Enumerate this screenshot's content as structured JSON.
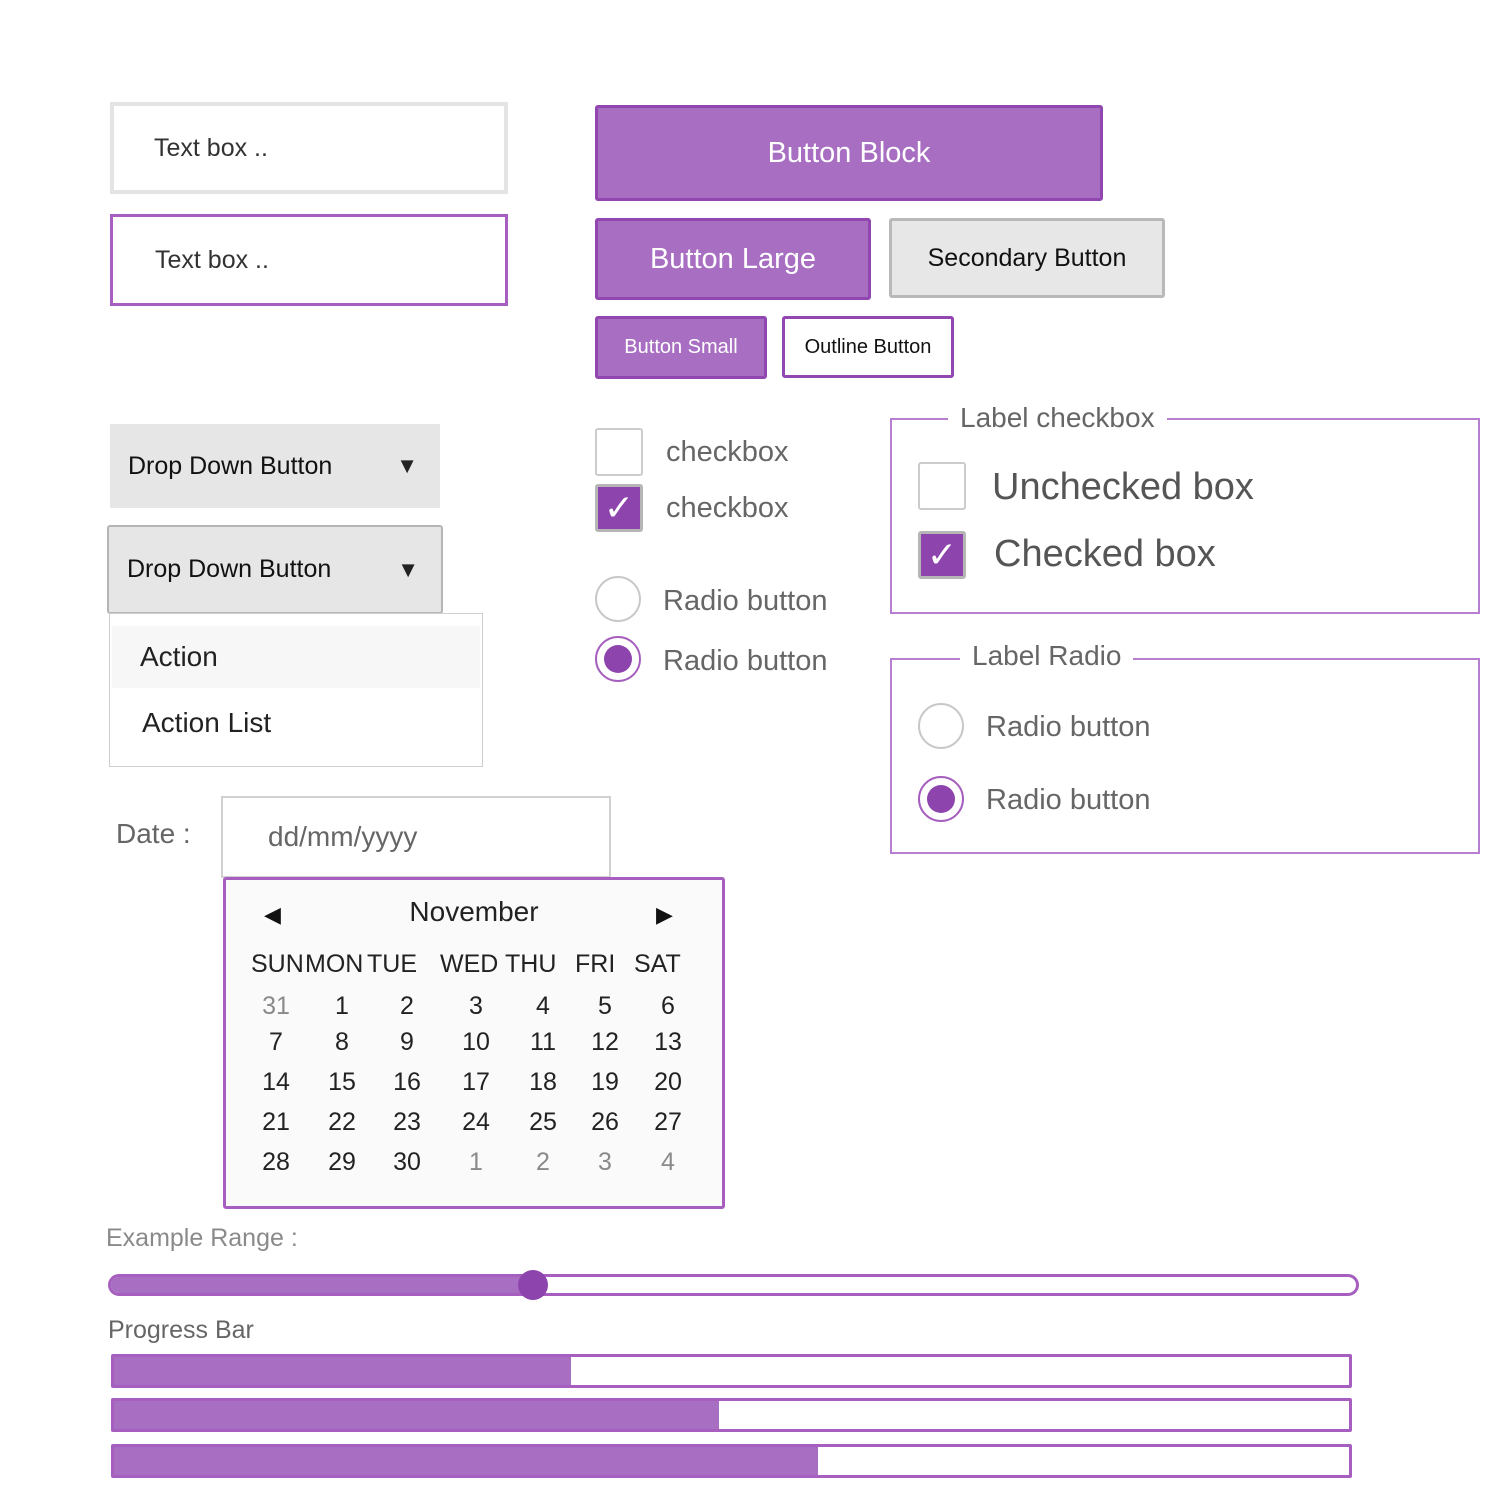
{
  "textboxes": [
    {
      "placeholder": "Text box .."
    },
    {
      "placeholder": "Text box .."
    }
  ],
  "buttons": {
    "block": "Button Block",
    "large": "Button Large",
    "secondary": "Secondary Button",
    "small": "Button Small",
    "outline": "Outline Button"
  },
  "dropdowns": [
    {
      "label": "Drop Down Button",
      "icon": "caret-down-icon"
    },
    {
      "label": "Drop Down Button",
      "icon": "caret-down-icon",
      "open": true
    }
  ],
  "dropdown_menu": [
    "Action",
    "Action List"
  ],
  "checkboxes": [
    {
      "label": "checkbox",
      "checked": false
    },
    {
      "label": "checkbox",
      "checked": true
    }
  ],
  "radios": [
    {
      "label": "Radio button",
      "selected": false
    },
    {
      "label": "Radio button",
      "selected": true
    }
  ],
  "checkbox_group": {
    "legend": "Label checkbox",
    "items": [
      {
        "label": "Unchecked box",
        "checked": false
      },
      {
        "label": "Checked box",
        "checked": true
      }
    ]
  },
  "radio_group": {
    "legend": "Label Radio",
    "items": [
      {
        "label": "Radio button",
        "selected": false
      },
      {
        "label": "Radio button",
        "selected": true
      }
    ]
  },
  "check_mark": "✓",
  "date": {
    "label": "Date :",
    "placeholder": "dd/mm/yyyy"
  },
  "calendar": {
    "month": "November",
    "prev_icon": "◀",
    "next_icon": "▶",
    "weekdays": [
      "SUN",
      "MON",
      "TUE",
      "WED",
      "THU",
      "FRI",
      "SAT"
    ],
    "weeks": [
      [
        "31",
        "1",
        "2",
        "3",
        "4",
        "5",
        "6"
      ],
      [
        "7",
        "8",
        "9",
        "10",
        "11",
        "12",
        "13"
      ],
      [
        "14",
        "15",
        "16",
        "17",
        "18",
        "19",
        "20"
      ],
      [
        "21",
        "22",
        "23",
        "24",
        "25",
        "26",
        "27"
      ],
      [
        "28",
        "29",
        "30",
        "1",
        "2",
        "3",
        "4"
      ]
    ]
  },
  "range": {
    "label": "Example Range :",
    "value_fraction": 0.34
  },
  "progress": {
    "label": "Progress Bar",
    "values_percent": [
      37,
      49,
      57
    ]
  },
  "colors": {
    "accent": "#8e44ad",
    "accent_light": "#a76ec1",
    "border_light": "#e4e4e4"
  }
}
